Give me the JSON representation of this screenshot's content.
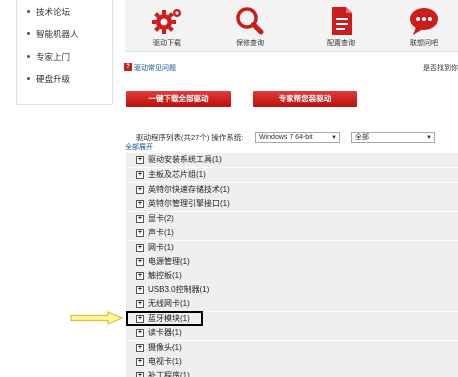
{
  "sidebar": {
    "items": [
      {
        "label": "技术论坛"
      },
      {
        "label": "智能机器人"
      },
      {
        "label": "专家上门"
      },
      {
        "label": "硬盘升级"
      }
    ]
  },
  "toolbar": {
    "items": [
      {
        "label": "驱动下载",
        "icon": "gears-icon"
      },
      {
        "label": "保修查询",
        "icon": "magnifier-icon"
      },
      {
        "label": "配置查询",
        "icon": "document-icon"
      },
      {
        "label": "联想问吧",
        "icon": "speech-bubble-icon"
      }
    ],
    "accent": "#cc1d1d"
  },
  "faq": {
    "text": "驱动常见问题"
  },
  "right_note": "是否找到你",
  "buttons": {
    "download_all": "一键下载全部驱动",
    "expert_install": "专家帮您装驱动"
  },
  "list": {
    "header_label": "驱动程序列表(共27个)  操作系统:",
    "os_select": "Windows 7 64-bit",
    "filter_select": "全部",
    "expand_all": "全部展开",
    "categories": [
      {
        "label": "驱动安装系统工具(1)"
      },
      {
        "label": "主板及芯片组(1)"
      },
      {
        "label": "英特尔快速存储技术(1)"
      },
      {
        "label": "英特尔管理引擎接口(1)"
      },
      {
        "label": "显卡(2)"
      },
      {
        "label": "声卡(1)"
      },
      {
        "label": "网卡(1)"
      },
      {
        "label": "电源管理(1)"
      },
      {
        "label": "触控板(1)"
      },
      {
        "label": "USB3.0控制器(1)"
      },
      {
        "label": "无线网卡(1)"
      },
      {
        "label": "蓝牙模块(1)"
      },
      {
        "label": "读卡器(1)"
      },
      {
        "label": "摄像头(1)"
      },
      {
        "label": "电视卡(1)"
      },
      {
        "label": "补丁程序(1)"
      }
    ],
    "expand_glyph": "+",
    "highlighted_index": 11
  }
}
